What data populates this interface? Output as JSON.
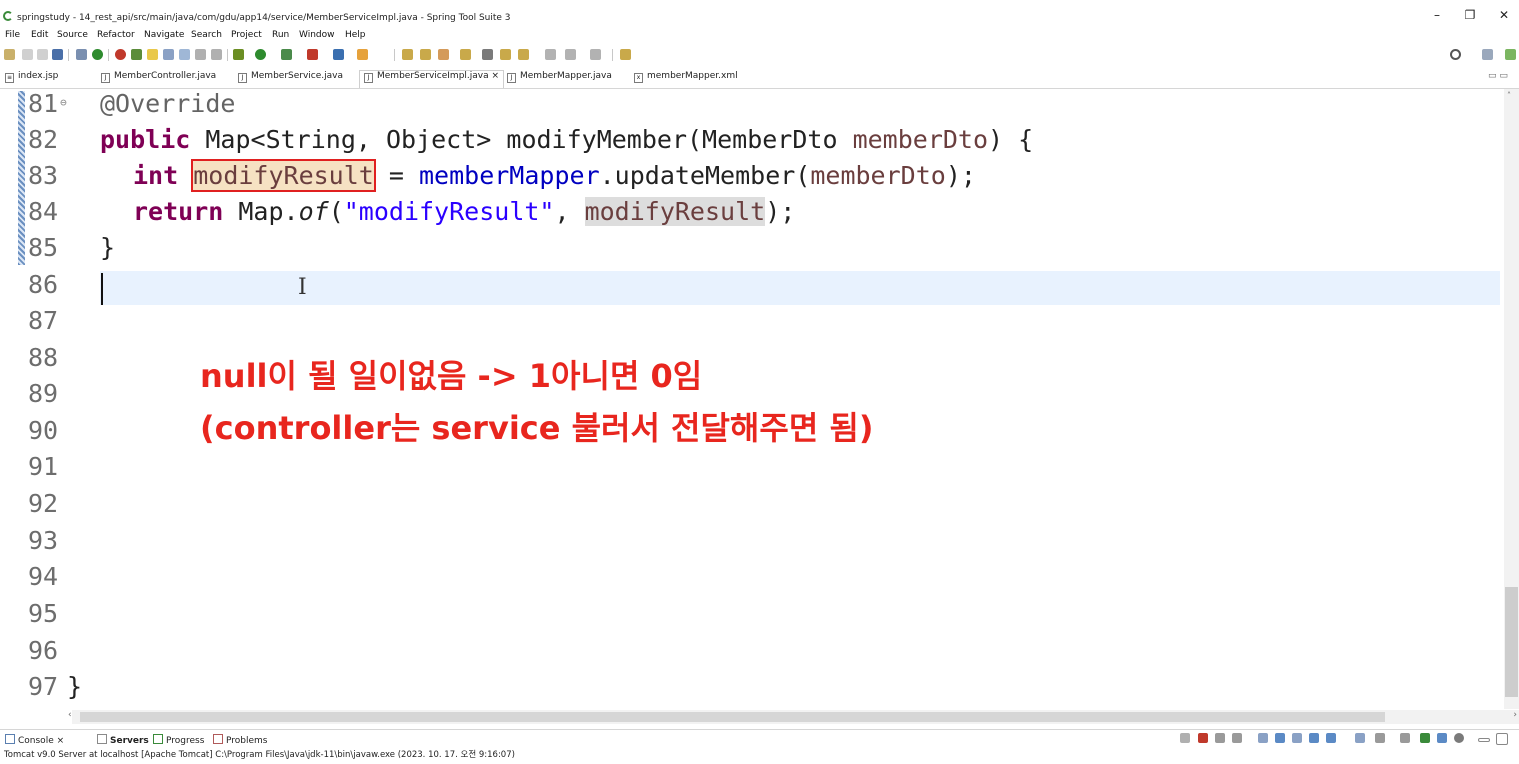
{
  "window": {
    "title": "springstudy - 14_rest_api/src/main/java/com/gdu/app14/service/MemberServiceImpl.java - Spring Tool Suite 3",
    "minimize": "–",
    "maximize": "❐",
    "close": "✕"
  },
  "menu": [
    "File",
    "Edit",
    "Source",
    "Refactor",
    "Navigate",
    "Search",
    "Project",
    "Run",
    "Window",
    "Help"
  ],
  "tabs": [
    {
      "label": "index.jsp",
      "icon": "jsp-file-icon"
    },
    {
      "label": "MemberController.java",
      "icon": "java-file-icon"
    },
    {
      "label": "MemberService.java",
      "icon": "java-file-icon"
    },
    {
      "label": "MemberServiceImpl.java",
      "icon": "java-file-icon",
      "active": true,
      "close": "×"
    },
    {
      "label": "MemberMapper.java",
      "icon": "java-file-icon"
    },
    {
      "label": "memberMapper.xml",
      "icon": "xml-file-icon"
    }
  ],
  "editor": {
    "line_numbers": [
      "81",
      "82",
      "83",
      "84",
      "85",
      "86",
      "87",
      "88",
      "89",
      "90",
      "91",
      "92",
      "93",
      "94",
      "95",
      "96",
      "97"
    ],
    "fold_marker": "⊖",
    "code": {
      "l81": "@Override",
      "l82_kw": "public",
      "l82_rest": " Map<String, Object> modifyMember(MemberDto ",
      "l82_var": "memberDto",
      "l82_end": ") {",
      "l83_kw": "int",
      "l83_var": "modifyResult",
      "l83_eq": " = ",
      "l83_fld": "memberMapper",
      "l83_call": ".updateMember(",
      "l83_arg": "memberDto",
      "l83_end": ");",
      "l84_kw": "return",
      "l84_map": " Map.",
      "l84_of": "of",
      "l84_open": "(",
      "l84_str": "\"modifyResult\"",
      "l84_comma": ", ",
      "l84_var": "modifyResult",
      "l84_end": ");",
      "l85": "}",
      "l97": "}"
    },
    "annotation": {
      "line1": "null이 될 일이없음 -> 1아니면 0임",
      "line2": "(controller는 service 불러서 전달해주면 됨)"
    },
    "cursor_glyph": "I"
  },
  "bottom_panel": {
    "tabs": [
      {
        "label": "Console",
        "close": "×"
      },
      {
        "label": "Servers"
      },
      {
        "label": "Progress"
      },
      {
        "label": "Problems"
      }
    ],
    "console_text": "Tomcat v9.0 Server at localhost [Apache Tomcat] C:\\Program Files\\Java\\jdk-11\\bin\\javaw.exe  (2023. 10. 17. 오전 9:16:07)"
  },
  "colors": {
    "keyword": "#7f0055",
    "field": "#0000c0",
    "string": "#2a00ff",
    "local_var": "#6a3e3e",
    "annotation_text": "#e8261e",
    "current_line": "#e8f2fe"
  }
}
